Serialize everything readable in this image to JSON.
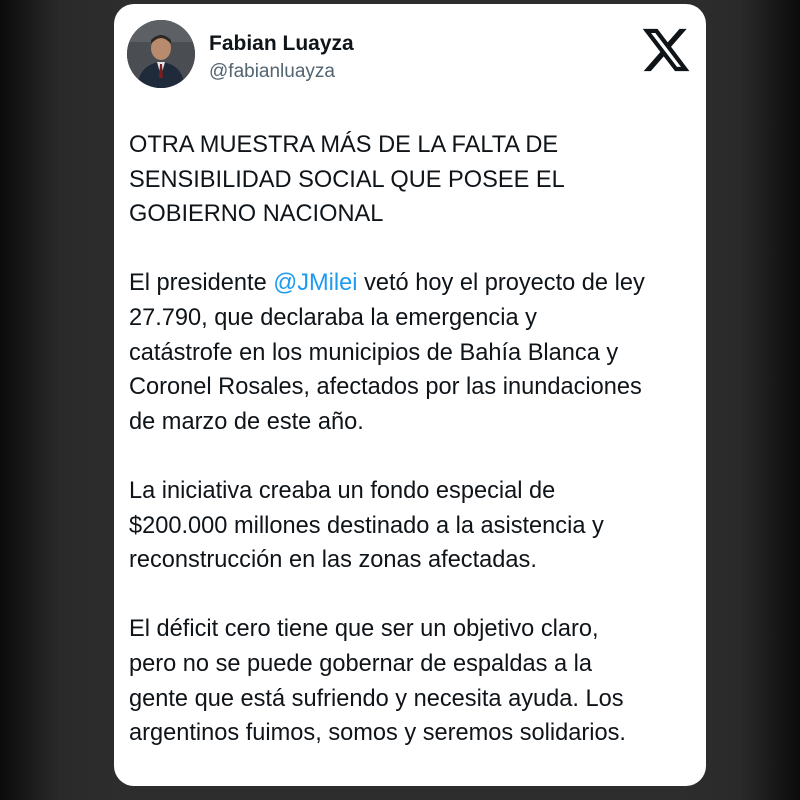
{
  "author": {
    "name": "Fabian Luayza",
    "handle": "@fabianluayza"
  },
  "icons": {
    "platform_logo": "x-logo-icon",
    "avatar": "profile-photo"
  },
  "colors": {
    "mention": "#1d9bf0",
    "text": "#0f1419",
    "handle": "#536471",
    "background": "#2d2d2d",
    "card": "#ffffff"
  },
  "tweet": {
    "headline": [
      "OTRA MUESTRA MÁS DE LA FALTA DE",
      "SENSIBILIDAD SOCIAL QUE POSEE EL",
      "GOBIERNO NACIONAL"
    ],
    "paragraph1": {
      "before_mention": "El presidente ",
      "mention": "@JMilei",
      "after_mention": " vetó hoy el proyecto de ley",
      "lines": [
        "27.790, que declaraba la emergencia y",
        "catástrofe en los municipios de Bahía Blanca y",
        "Coronel Rosales, afectados por las inundaciones",
        "de marzo de este año."
      ]
    },
    "paragraph2": [
      "La iniciativa creaba un fondo especial de",
      "$200.000 millones destinado a la asistencia y",
      "reconstrucción en las zonas afectadas."
    ],
    "paragraph3": [
      "El déficit cero tiene que ser un objetivo claro,",
      "pero no se puede gobernar de espaldas a la",
      "gente que está sufriendo y necesita ayuda. Los",
      "argentinos fuimos, somos y seremos solidarios."
    ]
  }
}
